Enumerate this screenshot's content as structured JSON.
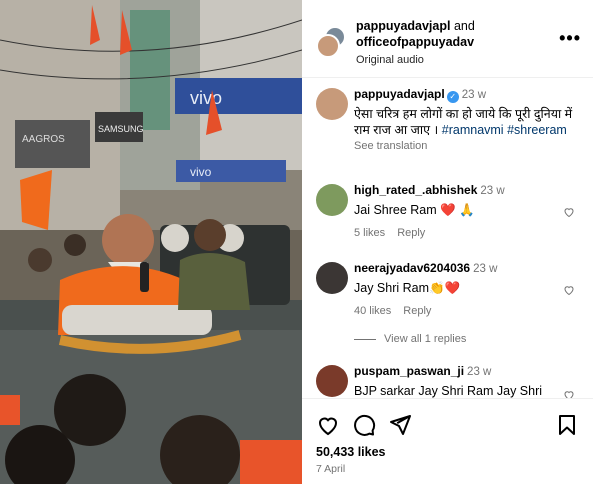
{
  "post_header": {
    "user1": "pappuyadavjapl",
    "and": "and",
    "user2": "officeofpappuyadav",
    "audio": "Original audio",
    "more_label": "•••"
  },
  "caption": {
    "user": "pappuyadavjapl",
    "time": "23 w",
    "text_part": "ऐसा चरित्र हम लोगों का हो जाये कि पूरी दुनिया में राम राज आ जाए ।",
    "hashtag1": "#ramnavmi",
    "hashtag2": "#shreeram",
    "translation": "See translation"
  },
  "comments": [
    {
      "user": "high_rated_.abhishek",
      "time": "23 w",
      "text": "Jai Shree Ram ❤️ 🙏",
      "likes": "5 likes",
      "reply": "Reply"
    },
    {
      "user": "neerajyadav6204036",
      "time": "23 w",
      "text": "Jay Shri Ram👏❤️",
      "likes": "40 likes",
      "reply": "Reply"
    },
    {
      "user": "puspam_paswan_ji",
      "time": "23 w",
      "text": "BJP sarkar Jay Shri Ram Jay Shri"
    }
  ],
  "view_replies": "View all 1 replies",
  "media_signs": {
    "vivo": "vivo",
    "samsung": "SAMSUNG",
    "aagros": "AAGROS",
    "vivo2": "vivo"
  },
  "footer": {
    "likes": "50,433 likes",
    "date": "7 April"
  },
  "colors": {
    "link": "#00376b",
    "verified": "#3897f0",
    "heart": "#ed4956",
    "saffron": "#f06a1c"
  },
  "icons": {
    "like": "heart-icon",
    "comment": "comment-icon",
    "share": "share-icon",
    "save": "bookmark-icon",
    "more": "more-icon"
  }
}
